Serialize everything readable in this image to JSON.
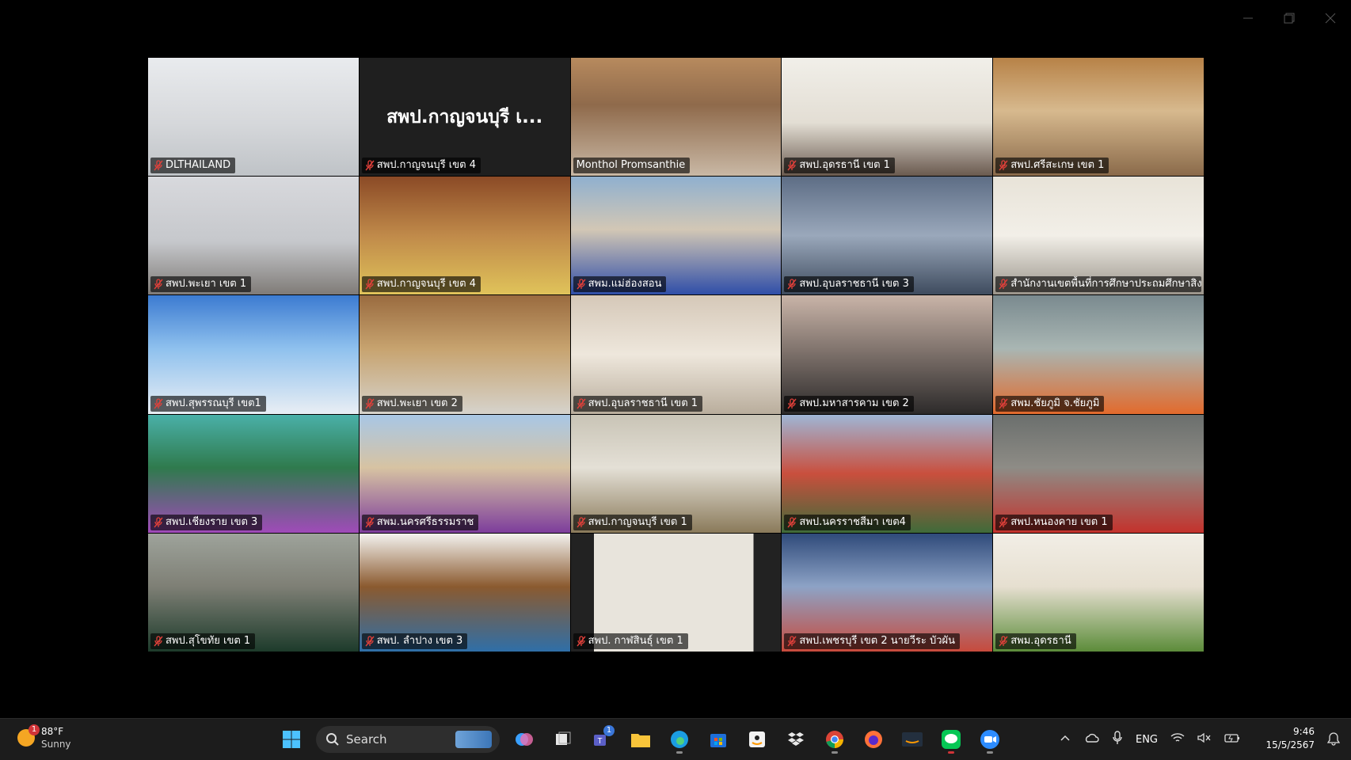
{
  "meeting": {
    "tiles": [
      {
        "name": "DLTHAILAND",
        "muted": true
      },
      {
        "name": "สพป.กาญจนบุรี เขต 4",
        "muted": true,
        "card_text": "สพป.กาญจนบุรี เ..."
      },
      {
        "name": "Monthol Promsanthie",
        "muted": false,
        "active": true
      },
      {
        "name": "สพป.อุดรธานี เขต 1",
        "muted": true
      },
      {
        "name": "สพป.ศรีสะเกษ เขต 1",
        "muted": true
      },
      {
        "name": "สพป.พะเยา เขต 1",
        "muted": true
      },
      {
        "name": "สพป.กาญจนบุรี เขต 4",
        "muted": true
      },
      {
        "name": "สพม.แม่ฮ่องสอน",
        "muted": true
      },
      {
        "name": "สพป.อุบลราชธานี เขต 3",
        "muted": true
      },
      {
        "name": "สำนักงานเขตพื้นที่การศึกษาประถมศึกษาสิง...",
        "muted": true
      },
      {
        "name": "สพป.สุพรรณบุรี เขต1",
        "muted": true
      },
      {
        "name": "สพป.พะเยา เขต 2",
        "muted": true
      },
      {
        "name": "สพป.อุบลราชธานี เขต 1",
        "muted": true
      },
      {
        "name": "สพป.มหาสารคาม เขต 2",
        "muted": true
      },
      {
        "name": "สพม.ชัยภูมิ จ.ชัยภูมิ",
        "muted": true
      },
      {
        "name": "สพป.เชียงราย เขต 3",
        "muted": true
      },
      {
        "name": "สพม.นครศรีธรรมราช",
        "muted": true
      },
      {
        "name": "สพป.กาญจนบุรี เขต 1",
        "muted": true
      },
      {
        "name": "สพป.นครราชสีมา เขต4",
        "muted": true
      },
      {
        "name": "สพป.หนองคาย เขต 1",
        "muted": true
      },
      {
        "name": "สพป.สุโขทัย เขต 1",
        "muted": true
      },
      {
        "name": "สพป. ลำปาง เขต 3",
        "muted": true
      },
      {
        "name": "สพป. กาฬสินธุ์ เขต 1",
        "muted": true
      },
      {
        "name": "สพป.เพชรบุรี เขต 2 นายวีระ บัวผัน",
        "muted": true
      },
      {
        "name": "สพม.อุดรธานี",
        "muted": true
      }
    ]
  },
  "taskbar": {
    "weather": {
      "temp": "88°F",
      "condition": "Sunny",
      "badge": "1"
    },
    "search_label": "Search",
    "teams_badge": "1",
    "language": "ENG",
    "time": "9:46",
    "date": "15/5/2567"
  },
  "colors": {
    "active_border": "#3fd27f",
    "muted_icon": "#e0403a",
    "taskbar_bg": "#1c1c1c"
  }
}
